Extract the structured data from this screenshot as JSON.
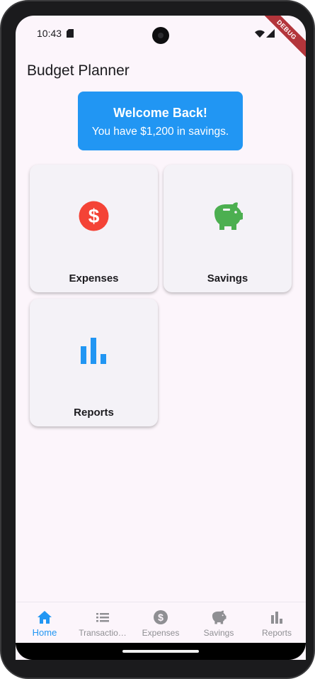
{
  "status_bar": {
    "time": "10:43",
    "debug_label": "DEBUG"
  },
  "app": {
    "title": "Budget Planner"
  },
  "welcome": {
    "title": "Welcome Back!",
    "subtitle": "You have $1,200 in savings."
  },
  "tiles": [
    {
      "label": "Expenses",
      "icon": "dollar-circle-icon",
      "color": "#f44336"
    },
    {
      "label": "Savings",
      "icon": "piggy-bank-icon",
      "color": "#4caf50"
    },
    {
      "label": "Reports",
      "icon": "bar-chart-icon",
      "color": "#2196f3"
    }
  ],
  "bottom_nav": {
    "active": "Home",
    "items": [
      {
        "label": "Home",
        "icon": "home-icon"
      },
      {
        "label": "Transactio…",
        "icon": "list-icon"
      },
      {
        "label": "Expenses",
        "icon": "dollar-circle-icon"
      },
      {
        "label": "Savings",
        "icon": "piggy-bank-icon"
      },
      {
        "label": "Reports",
        "icon": "bar-chart-icon"
      }
    ]
  },
  "colors": {
    "primary": "#2196f3",
    "expenses": "#f44336",
    "savings": "#4caf50",
    "background": "#fcf5fb",
    "inactive": "#8f8f93"
  }
}
